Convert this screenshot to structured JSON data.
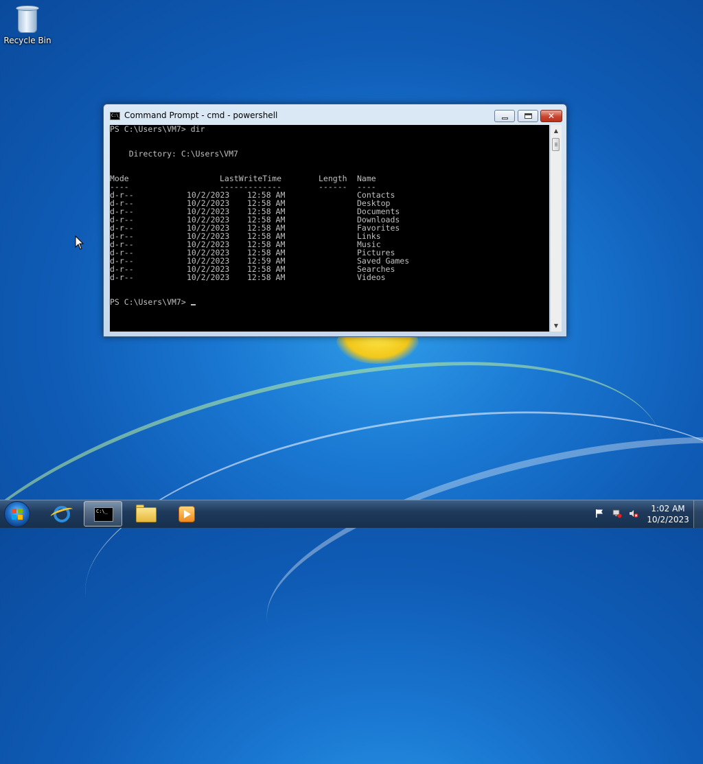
{
  "desktop": {
    "icons": [
      {
        "label": "Recycle Bin",
        "icon": "recycle-bin-icon"
      }
    ]
  },
  "window": {
    "title": "Command Prompt - cmd - powershell",
    "controls": {
      "minimize": "minimize-icon",
      "maximize": "maximize-icon",
      "close": "close-icon",
      "close_glyph": "✕"
    }
  },
  "console": {
    "prompt_command": "PS C:\\Users\\VM7> dir",
    "directory_line": "    Directory: C:\\Users\\VM7",
    "headers": {
      "mode": "Mode",
      "last_write_time": "LastWriteTime",
      "length": "Length",
      "name": "Name"
    },
    "underlines": {
      "mode": "----",
      "last_write_time": "-------------",
      "length": "------",
      "name": "----"
    },
    "rows": [
      {
        "mode": "d-r--",
        "date": "10/2/2023",
        "time": "12:58 AM",
        "length": "",
        "name": "Contacts"
      },
      {
        "mode": "d-r--",
        "date": "10/2/2023",
        "time": "12:58 AM",
        "length": "",
        "name": "Desktop"
      },
      {
        "mode": "d-r--",
        "date": "10/2/2023",
        "time": "12:58 AM",
        "length": "",
        "name": "Documents"
      },
      {
        "mode": "d-r--",
        "date": "10/2/2023",
        "time": "12:58 AM",
        "length": "",
        "name": "Downloads"
      },
      {
        "mode": "d-r--",
        "date": "10/2/2023",
        "time": "12:58 AM",
        "length": "",
        "name": "Favorites"
      },
      {
        "mode": "d-r--",
        "date": "10/2/2023",
        "time": "12:58 AM",
        "length": "",
        "name": "Links"
      },
      {
        "mode": "d-r--",
        "date": "10/2/2023",
        "time": "12:58 AM",
        "length": "",
        "name": "Music"
      },
      {
        "mode": "d-r--",
        "date": "10/2/2023",
        "time": "12:58 AM",
        "length": "",
        "name": "Pictures"
      },
      {
        "mode": "d-r--",
        "date": "10/2/2023",
        "time": "12:59 AM",
        "length": "",
        "name": "Saved Games"
      },
      {
        "mode": "d-r--",
        "date": "10/2/2023",
        "time": "12:58 AM",
        "length": "",
        "name": "Searches"
      },
      {
        "mode": "d-r--",
        "date": "10/2/2023",
        "time": "12:58 AM",
        "length": "",
        "name": "Videos"
      }
    ],
    "final_prompt": "PS C:\\Users\\VM7> "
  },
  "taskbar": {
    "items": [
      {
        "name": "start-button",
        "icon": "windows-orb-icon"
      },
      {
        "name": "internet-explorer",
        "icon": "internet-explorer-icon"
      },
      {
        "name": "command-prompt",
        "icon": "command-prompt-icon",
        "glyph": "C:\\_"
      },
      {
        "name": "windows-explorer",
        "icon": "folder-icon"
      },
      {
        "name": "windows-media-player",
        "icon": "media-player-icon"
      }
    ],
    "tray": {
      "icons": [
        "action-center-flag-icon",
        "network-icon",
        "volume-muted-icon"
      ],
      "time": "1:02 AM",
      "date": "10/2/2023"
    }
  },
  "colors": {
    "console_bg": "#000000",
    "console_text": "#c0c0c0",
    "desktop_blue": "#1a78d2",
    "close_button_red": "#c9452f"
  }
}
